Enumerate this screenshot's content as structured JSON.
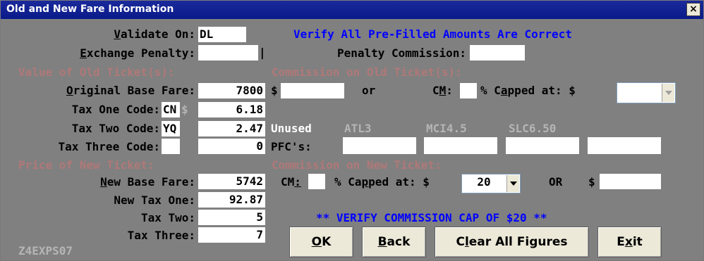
{
  "window": {
    "title": "Old and New Fare Information",
    "close_glyph": "×"
  },
  "validate_on": {
    "label_u": "V",
    "label_rest": "alidate On:",
    "value": "DL"
  },
  "verify_notice": "Verify All Pre-Filled Amounts Are Correct",
  "exchange_penalty": {
    "label_u": "E",
    "label_rest": "xchange Penalty:",
    "value": "",
    "marker": "|"
  },
  "penalty_commission": {
    "label": "Penalty Commission:",
    "value": ""
  },
  "old_section": {
    "heading": "Value of Old Ticket(s):"
  },
  "original_base_fare": {
    "label_u": "O",
    "label_rest": "riginal Base Fare:",
    "value": "7800"
  },
  "old_tax1": {
    "label": "Tax One Code:",
    "code": "CN",
    "dollar": "$",
    "value": "6.18"
  },
  "old_tax2": {
    "label": "Tax Two Code:",
    "code": "YQ",
    "value": "2.47"
  },
  "old_tax3": {
    "label": "Tax Three Code:",
    "code": "",
    "value": "0"
  },
  "old_commission": {
    "heading": "Commission on Old Ticket(s):",
    "dollar": "$",
    "amount": "",
    "or": "or",
    "cm_label_pre": "C",
    "cm_label_u": "M",
    "cm_label_post": ":",
    "cm_value": "",
    "capped_pre": "% C",
    "capped_u": "a",
    "capped_post": "pped at: $",
    "cap_value": ""
  },
  "unused": {
    "label": "Unused",
    "airports": [
      "ATL3",
      "MCI4.5",
      "SLC6.50"
    ],
    "pfc_label": "PFC's:",
    "pfc_values": [
      "",
      "",
      "",
      ""
    ]
  },
  "new_section": {
    "heading": "Price of New Ticket:"
  },
  "new_base_fare": {
    "label_u": "N",
    "label_rest": "ew Base Fare:",
    "value": "5742"
  },
  "new_tax1": {
    "label": "New Tax One:",
    "value": "92.87"
  },
  "new_tax2": {
    "label": "Tax Two:",
    "value": "5"
  },
  "new_tax3": {
    "label": "Tax Three:",
    "value": "7"
  },
  "new_commission": {
    "heading": "Commission on New Ticket:",
    "cm_label_pre": "CM",
    "cm_label_u": ":",
    "cm_value": "",
    "capped_pre": "% Ca",
    "capped_u": "p",
    "capped_post": "ped at: $",
    "cap_value": "20",
    "or_label": "OR",
    "dollar": "$",
    "amount": ""
  },
  "cap_notice": "** VERIFY COMMISSION CAP OF $20 **",
  "screen_id": "Z4EXPS07",
  "buttons": {
    "ok": {
      "u": "O",
      "rest": "K"
    },
    "back": {
      "u": "B",
      "rest": "ack"
    },
    "clear": {
      "pre": "C",
      "u": "l",
      "rest": "ear All Figures"
    },
    "exit": {
      "pre": "E",
      "u": "x",
      "rest": "it"
    }
  }
}
